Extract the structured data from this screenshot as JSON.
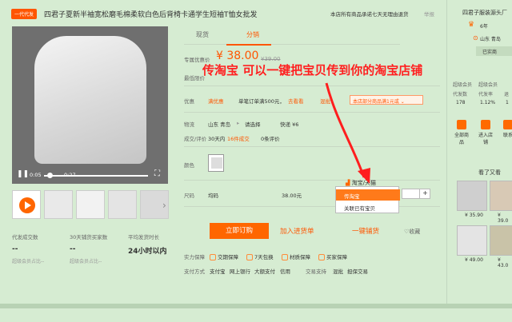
{
  "header": {
    "tag": "一代代发",
    "title": "四君子夏新半袖宽松磨毛棉柔软白色后背椅卡通学生短袖T恤女批发",
    "promise": "本店所有商品承诺七天无理由退货",
    "promise_link": "",
    "report": "举报"
  },
  "video": {
    "time_current": "0:05",
    "time_total": "0:27"
  },
  "stats": [
    {
      "label": "代发成交数",
      "value": "--",
      "sub": "超级会员占比--"
    },
    {
      "label": "30天铺货买家数",
      "value": "--",
      "sub": "超级会员占比--"
    },
    {
      "label": "平均发货时长",
      "value": "24小时以内",
      "sub": ""
    }
  ],
  "tabs": {
    "tab1": "现货",
    "tab2": "分销"
  },
  "price": {
    "label1": "专属优惠价",
    "label2": "最低限价",
    "current": "¥ 38.00",
    "old": "¥39.00"
  },
  "overlay_text": "传淘宝 可以一键把宝贝传到你的淘宝店铺",
  "promo": {
    "label": "优惠",
    "item1": "满优惠",
    "item2": "单笔订单满500元，",
    "item3": "去看看",
    "item4": "混批",
    "box": "本店部分商品满1元或"
  },
  "logistics": {
    "label": "物流",
    "from": "山东 青岛",
    "to": "请选择",
    "express": "快递 ¥6"
  },
  "reviews": {
    "label": "成交/评价",
    "deals": "30天内",
    "deals_n": "16件成交",
    "reviews": "0条评价"
  },
  "color": {
    "label": "颜色"
  },
  "size": {
    "label": "尺码",
    "value": "均码",
    "price": "38.00元"
  },
  "popup": {
    "title": "淘宝/天猫",
    "opt1": "传淘宝",
    "opt2": "关联已有宝贝"
  },
  "buttons": {
    "order": "立即订购",
    "stock": "加入进货单",
    "onekey": "一键铺货",
    "fav": "收藏"
  },
  "guarantee": {
    "label": "实力保障",
    "items": [
      "交期保障",
      "7天包换",
      "材质保障",
      "买家保障"
    ],
    "pay_label": "支付方式",
    "pays": [
      "支付宝",
      "网上银行",
      "大额支付",
      "信用"
    ],
    "trade_label": "交易支持",
    "trades": [
      "混批",
      "担保交易"
    ]
  },
  "shop": {
    "name": "四君子服装源头厂",
    "years": "6年",
    "location": "山东 青岛",
    "verified": "已实商",
    "stat_labels": [
      "超级会员",
      "超级会员"
    ],
    "stat_row2_labels": [
      "代发数",
      "代发率",
      "退"
    ],
    "stat_values": [
      "178",
      "1.12%",
      "1"
    ],
    "icons": [
      "全部商品",
      "进入店铺",
      "联系"
    ],
    "see_more": "看了又看",
    "prices": [
      "¥ 35.90",
      "¥ 39.0",
      "¥ 49.00",
      "¥ 43.0"
    ]
  },
  "colors": {
    "accent": "#ff5500",
    "background": "#d6ecd2",
    "overlay": "#ff2020"
  }
}
